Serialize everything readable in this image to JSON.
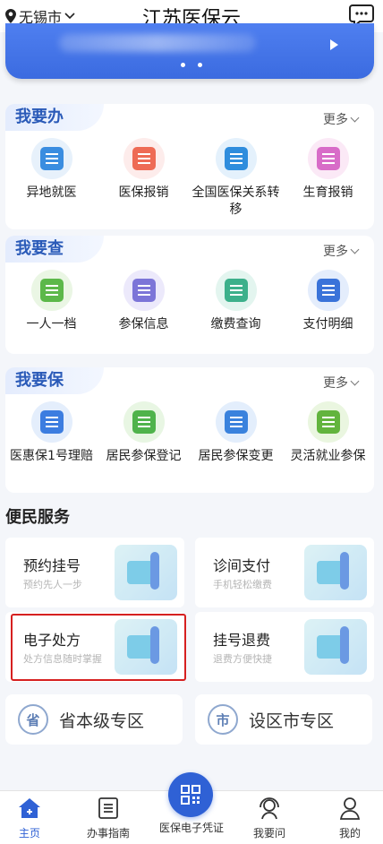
{
  "header": {
    "location": "无锡市",
    "title": "江苏医保云"
  },
  "sections": [
    {
      "title": "我要办",
      "more": "更多",
      "items": [
        {
          "label": "异地就医",
          "icon": "id-card-icon",
          "bg": "#e7f1fb",
          "fg": "#3a8de0"
        },
        {
          "label": "医保报销",
          "icon": "reimburse-icon",
          "bg": "#fdeceb",
          "fg": "#ee6b55"
        },
        {
          "label": "全国医保关系转移",
          "icon": "transfer-icon",
          "bg": "#e4f1fc",
          "fg": "#2f8ddd"
        },
        {
          "label": "生育报销",
          "icon": "baby-icon",
          "bg": "#fbe9f6",
          "fg": "#d86cc8"
        }
      ]
    },
    {
      "title": "我要查",
      "more": "更多",
      "items": [
        {
          "label": "一人一档",
          "icon": "archive-icon",
          "bg": "#eaf6e4",
          "fg": "#5cb84a"
        },
        {
          "label": "参保信息",
          "icon": "info-card-icon",
          "bg": "#ece9fb",
          "fg": "#7c75d8"
        },
        {
          "label": "缴费查询",
          "icon": "payment-query-icon",
          "bg": "#e3f5ef",
          "fg": "#3db08b"
        },
        {
          "label": "支付明细",
          "icon": "yuan-doc-icon",
          "bg": "#e4edfc",
          "fg": "#3a73d9"
        }
      ]
    },
    {
      "title": "我要保",
      "more": "更多",
      "items": [
        {
          "label": "医惠保1号理赔",
          "icon": "leaf-icon",
          "bg": "#e4eefc",
          "fg": "#3c7de0"
        },
        {
          "label": "居民参保登记",
          "icon": "register-icon",
          "bg": "#e8f6e3",
          "fg": "#4fb34b"
        },
        {
          "label": "居民参保变更",
          "icon": "edit-doc-icon",
          "bg": "#e3eefc",
          "fg": "#3a82dd"
        },
        {
          "label": "灵活就业参保",
          "icon": "insure-icon",
          "bg": "#eaf6e0",
          "fg": "#62b43d"
        }
      ]
    }
  ],
  "services": {
    "title": "便民服务",
    "items": [
      {
        "name": "预约挂号",
        "sub": "预约先人一步"
      },
      {
        "name": "诊间支付",
        "sub": "手机轻松缴费"
      },
      {
        "name": "电子处方",
        "sub": "处方信息随时掌握"
      },
      {
        "name": "挂号退费",
        "sub": "退费方便快捷"
      }
    ]
  },
  "zones": [
    {
      "icon_text": "省",
      "label": "省本级专区"
    },
    {
      "icon_text": "市",
      "label": "设区市专区"
    }
  ],
  "nav": {
    "items": [
      "主页",
      "办事指南",
      "医保电子凭证",
      "我要问",
      "我的"
    ],
    "active_color": "#2f61d5"
  }
}
